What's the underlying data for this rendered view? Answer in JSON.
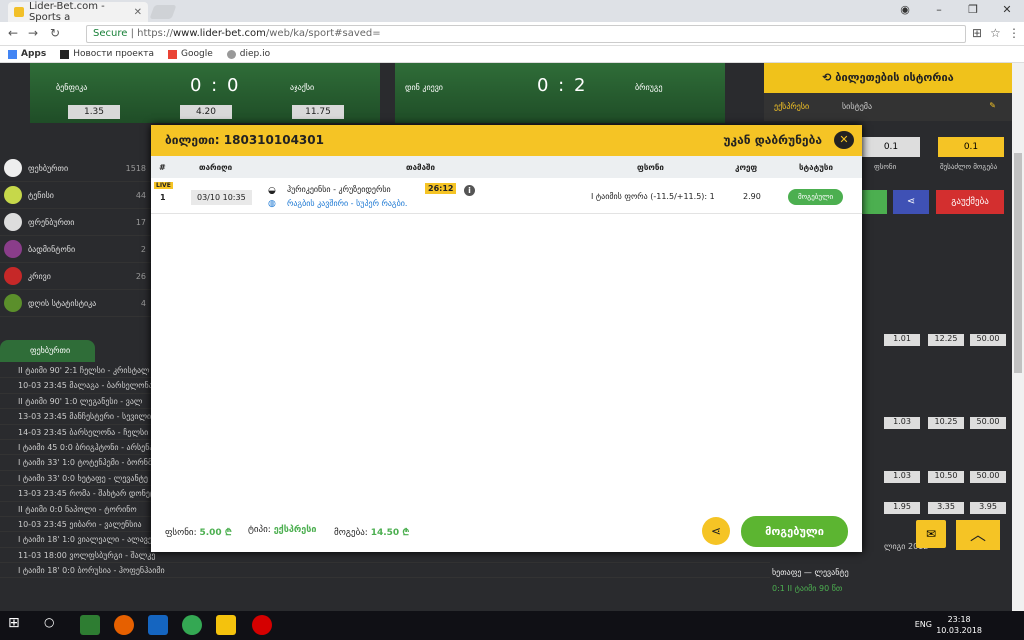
{
  "browser": {
    "tab_title": "Lider-Bet.com - Sports a",
    "secure": "Secure",
    "url_scheme": "https://",
    "url_host": "www.lider-bet.com",
    "url_path": "/web/ka/sport#saved=",
    "bookmarks": [
      "Apps",
      "Новости проекта",
      "Google",
      "diep.io"
    ]
  },
  "banner": {
    "left_home": "ბენფიკა",
    "left_score": "0 : 0",
    "left_away": "აჯაქსი",
    "left_odds": [
      "1.35",
      "4.20",
      "11.75"
    ],
    "right_home": "დინ კიევი",
    "right_score": "0 : 2",
    "right_away": "ბრიუგე"
  },
  "history": {
    "title": "ბილეთების ისტორია",
    "tab1": "ექსპრესი",
    "tab2": "სისტემა",
    "amount1": "0.1",
    "amount2": "0.1",
    "lbl1": "ფსონი",
    "lbl2": "შესაძლო მოგება",
    "delete": "გაუქმება",
    "right_odds": [
      "1.01",
      "12.25",
      "50.00",
      "1.03",
      "10.25",
      "50.00",
      "1.03",
      "10.50",
      "50.00",
      "1.95",
      "3.35",
      "3.95"
    ],
    "league": "ლიგი 2012",
    "live_rows": [
      "ხეთაფე — ლევანტე",
      "0:1 II ტაიმი 90 წთ"
    ]
  },
  "sports": [
    {
      "name": "ფეხბურთი",
      "n": "1518"
    },
    {
      "name": "ტენისი",
      "n": "44"
    },
    {
      "name": "ფრენბურთი",
      "n": "17"
    },
    {
      "name": "ბადმინტონი",
      "n": "2"
    },
    {
      "name": "კრივი",
      "n": "26"
    },
    {
      "name": "დღის სტატისტიკა",
      "n": "4"
    }
  ],
  "tabs": {
    "football": "ფეხბურთი"
  },
  "bg_rows": [
    "II ტაიმი 90' 2:1 ჩელსი - კრისტალ",
    "10-03 23:45 მალაგა - ბარსელონა",
    "II ტაიმი 90' 1:0 ლეგანესი - ვალ",
    "13-03 23:45 მანჩესტერი - სევილია",
    "14-03 23:45 ბარსელონა - ჩელსი",
    "I ტაიმი 45 0:0 ბრიგჰტონი - არსენალი",
    "I ტაიმი 33' 1:0 ტოტენჰემი - ბორნმუთი",
    "I ტაიმი 33' 0:0 ხეტაფე - ლევანტე",
    "13-03 23:45 რომა - შახტარ დონეცკი",
    "II ტაიმი 0:0 ნაპოლი - ტორინო",
    "10-03 23:45 ეიბარი - ვალენსია",
    "I ტაიმი 18' 1:0 ვიალეალი - ალავესი",
    "11-03 18:00 ვოლფსბურგი - შალკე",
    "I ტაიმი 18' 0:0 ბორუსია - ჰოფენჰაიმი"
  ],
  "modal": {
    "ticket_label": "ბილეთი:",
    "ticket_no": "180310104301",
    "back": "უკან დაბრუნება",
    "close": "✕",
    "cols": {
      "num": "#",
      "date": "თარიღი",
      "event": "თამაში",
      "bet": "ფსონი",
      "odd": "კოეფ",
      "status": "სტატუსი"
    },
    "row": {
      "live": "LIVE",
      "num": "1",
      "date": "03/10 10:35",
      "event": "ჰურიკეინსი - კრუზეიდერსი",
      "time": "26:12",
      "league": "რაგბის კავშირი - სუპერ რაგბი.",
      "bet": "I ტაიმის ფორა (-11.5/+11.5): 1",
      "odd": "2.90",
      "status": "მოგებული"
    },
    "stake_label": "ფსონი:",
    "stake": "5.00 ₾",
    "type_label": "ტიპი:",
    "type": "ექსპრესი",
    "win_label": "მოგება:",
    "win": "14.50 ₾",
    "status_btn": "მოგებული"
  },
  "taskbar": {
    "lang": "ENG",
    "time": "23:18",
    "date": "10.03.2018"
  }
}
